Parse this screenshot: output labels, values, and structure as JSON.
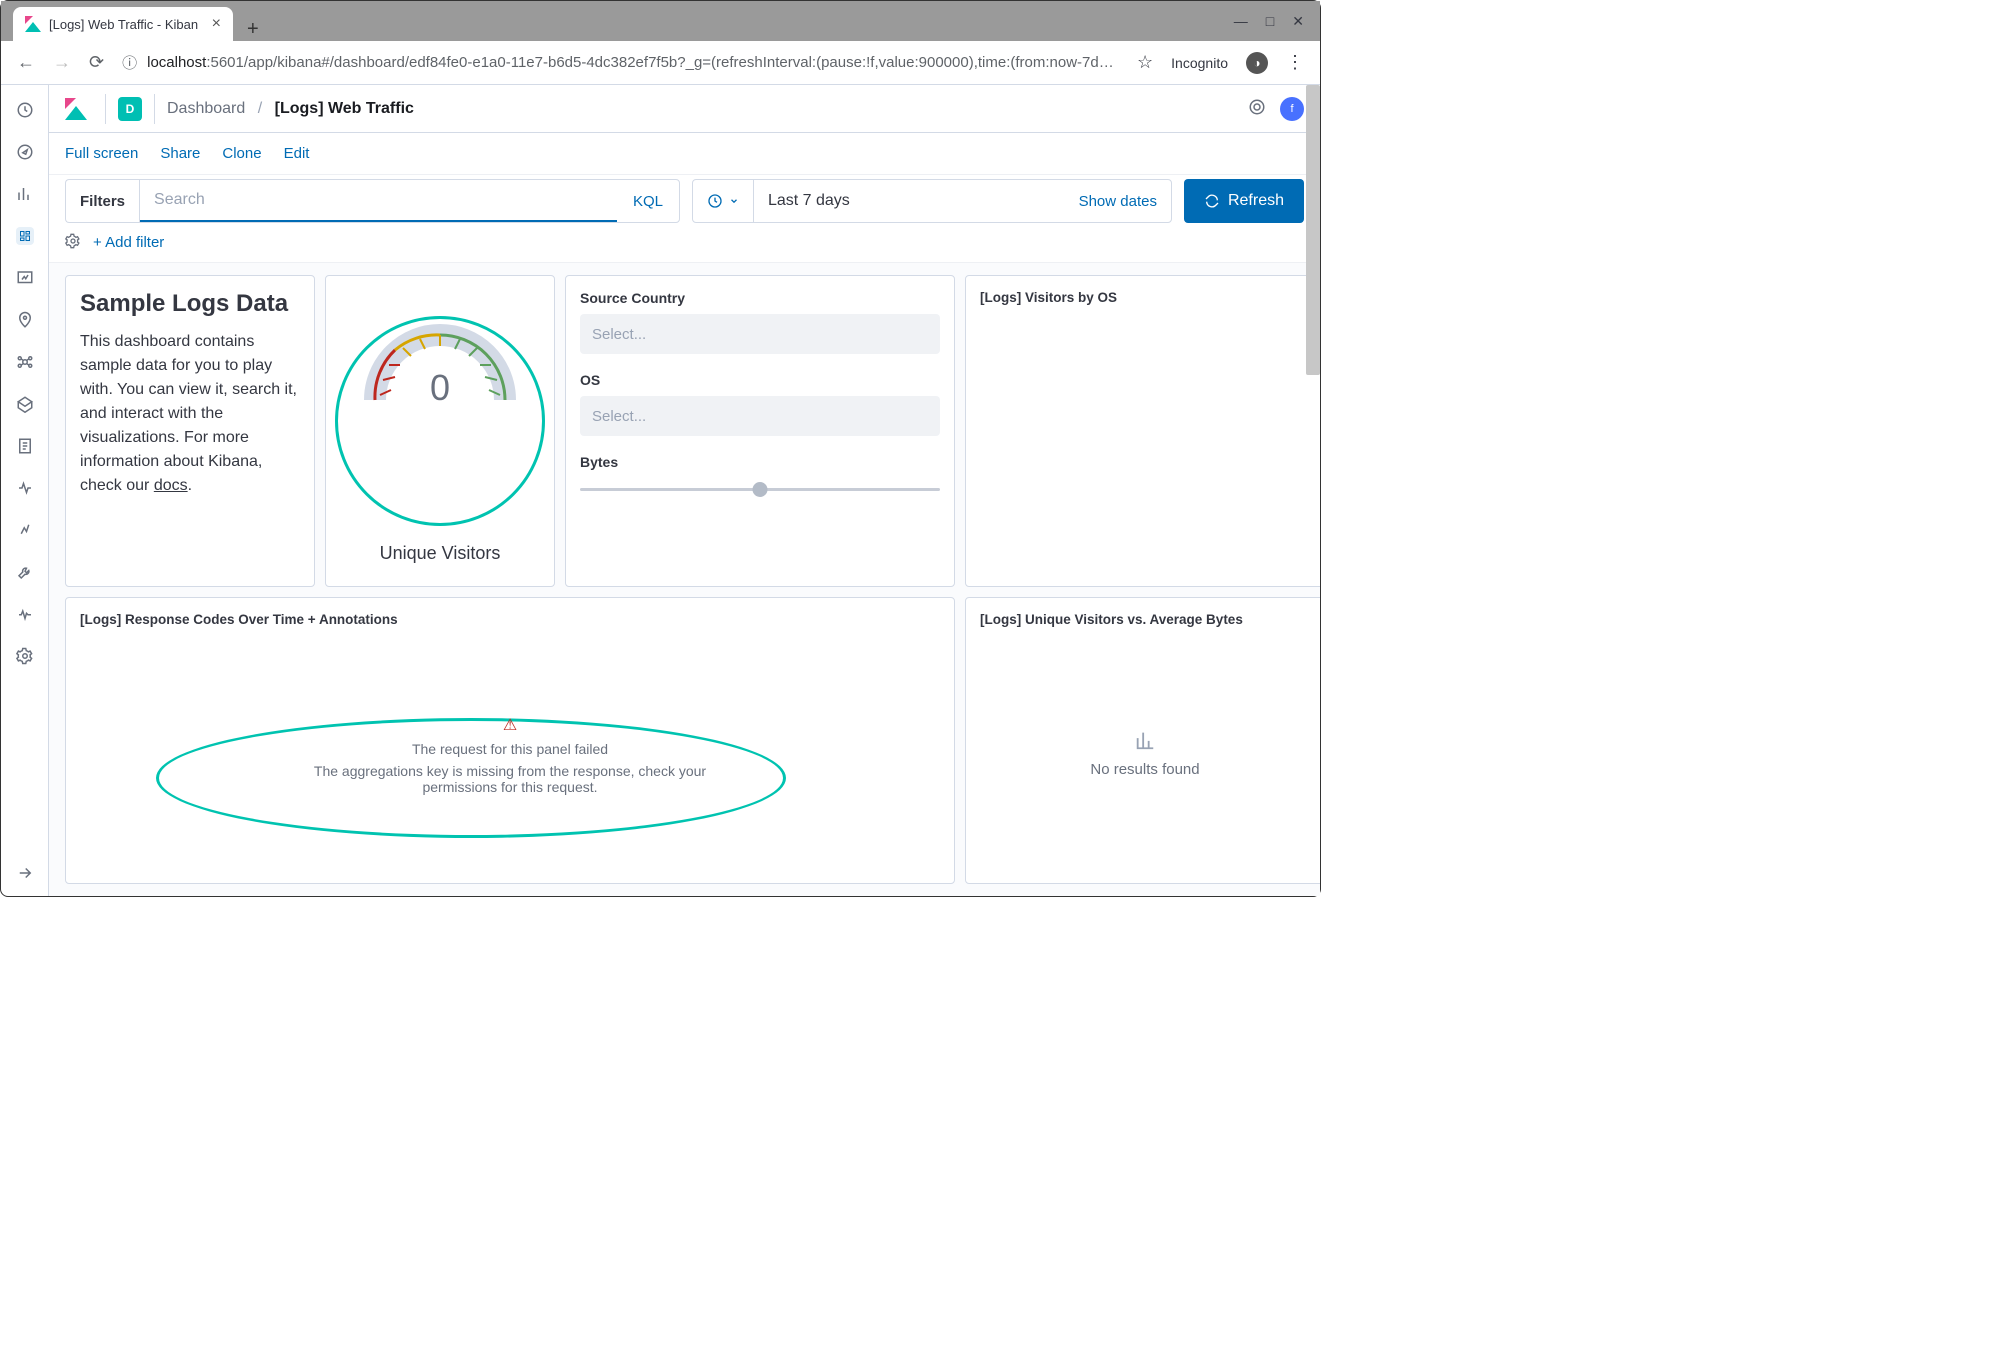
{
  "browser": {
    "tab_title": "[Logs] Web Traffic - Kiban",
    "new_tab_glyph": "+",
    "window_min": "—",
    "window_max": "□",
    "window_close": "✕",
    "url_info_icon": "ⓘ",
    "url_host": "localhost",
    "url_path": ":5601/app/kibana#/dashboard/edf84fe0-e1a0-11e7-b6d5-4dc382ef7f5b?_g=(refreshInterval:(pause:!f,value:900000),time:(from:now-7d…",
    "star": "☆",
    "incognito_label": "Incognito",
    "incognito_glyph": "◑",
    "menu_glyph": "⋮"
  },
  "header": {
    "space_letter": "D",
    "breadcrumb_root": "Dashboard",
    "breadcrumb_sep": "/",
    "breadcrumb_current": "[Logs] Web Traffic",
    "avatar_letter": "f"
  },
  "toolbar": {
    "full_screen": "Full screen",
    "share": "Share",
    "clone": "Clone",
    "edit": "Edit"
  },
  "search": {
    "filters_label": "Filters",
    "placeholder": "Search",
    "kql": "KQL",
    "date_range": "Last 7 days",
    "show_dates": "Show dates",
    "refresh": "Refresh",
    "add_filter": "+ Add filter"
  },
  "panels": {
    "intro": {
      "title": "Sample Logs Data",
      "body_pre": "This dashboard contains sample data for you to play with. You can view it, search it, and interact with the visualizations. For more information about Kibana, check our ",
      "docs": "docs",
      "body_post": "."
    },
    "gauge": {
      "value": "0",
      "label": "Unique Visitors"
    },
    "controls": {
      "source_country": "Source Country",
      "os": "OS",
      "bytes": "Bytes",
      "select_placeholder": "Select..."
    },
    "visitors_os_title": "[Logs] Visitors by OS",
    "response_title": "[Logs] Response Codes Over Time + Annotations",
    "response_err1": "The request for this panel failed",
    "response_err2": "The aggregations key is missing from the response, check your permissions for this request.",
    "bytes_title": "[Logs] Unique Visitors vs. Average Bytes",
    "no_results": "No results found"
  },
  "chart_data": {
    "type": "pie",
    "title": "Unique Visitors",
    "value": 0,
    "min": 0,
    "max": 100
  }
}
